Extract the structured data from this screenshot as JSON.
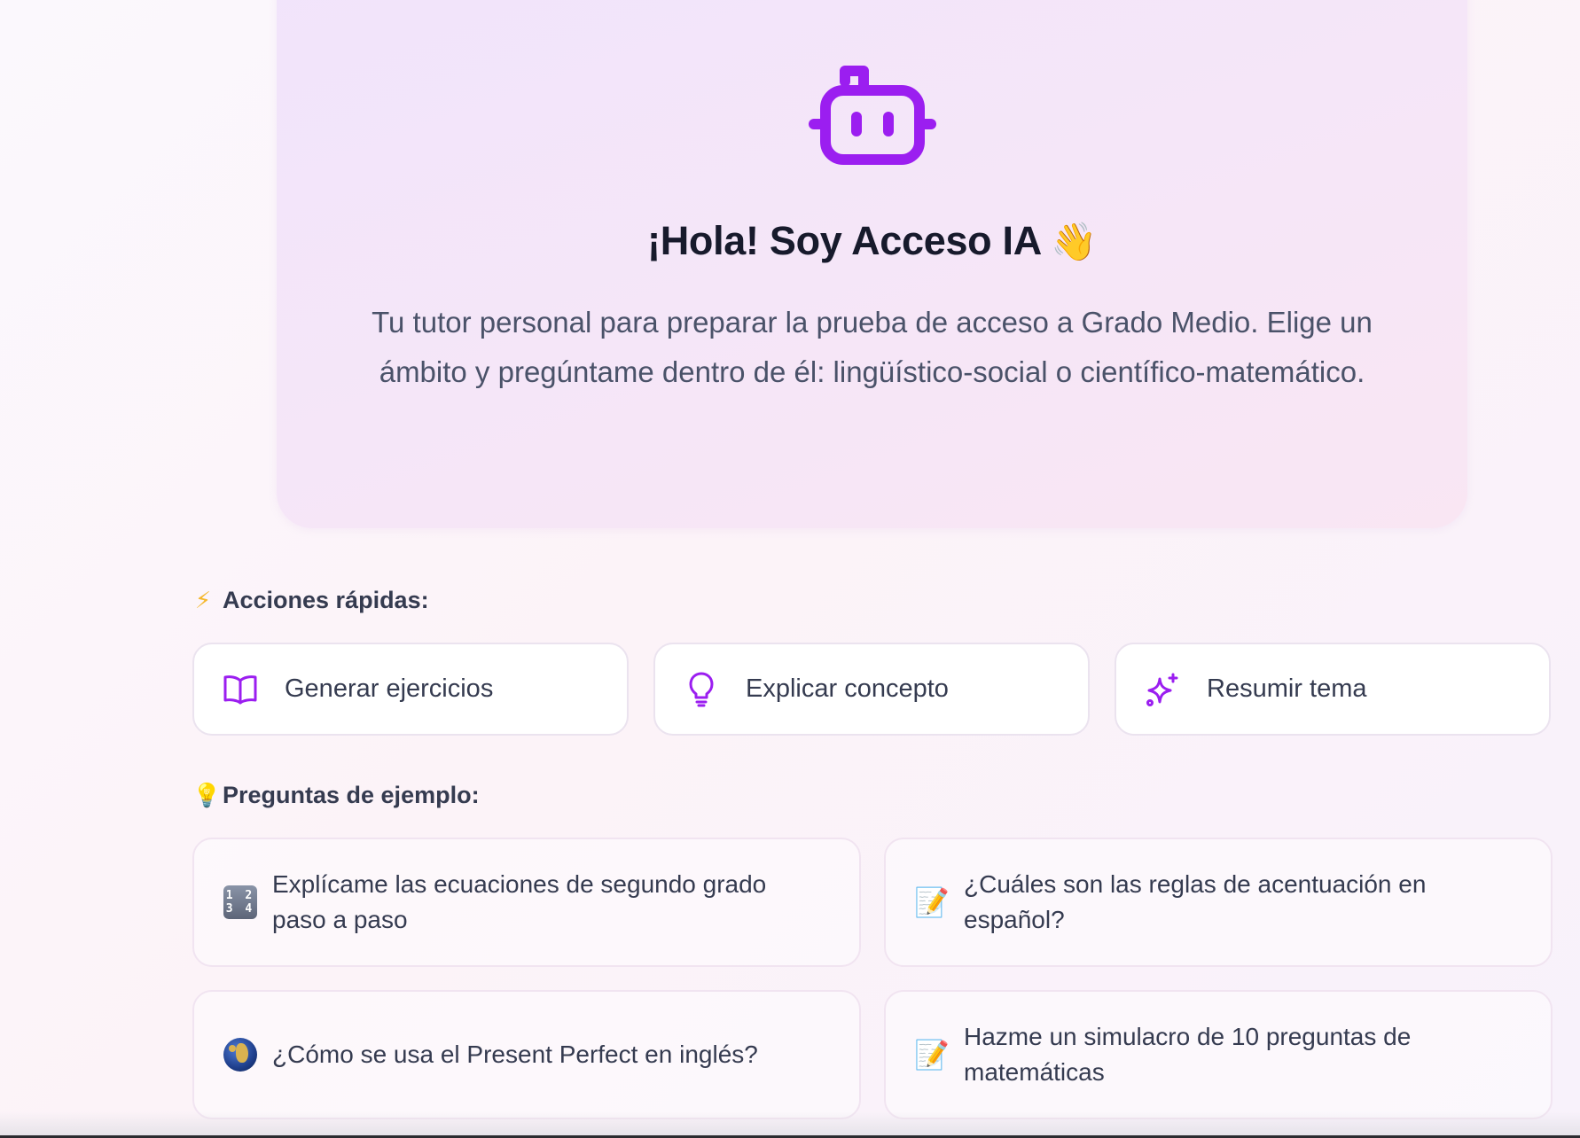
{
  "hero": {
    "title": "¡Hola! Soy Acceso IA",
    "title_emoji": "👋",
    "subtitle": "Tu tutor personal para preparar la prueba de acceso a Grado Medio. Elige un ámbito y pregúntame dentro de él: lingüístico-social o científico-matemático.",
    "icon": "robot-icon",
    "accent_color": "#9b1ef0"
  },
  "quick_actions": {
    "heading_emoji": "⚡",
    "heading": "Acciones rápidas:",
    "items": [
      {
        "label": "Generar ejercicios",
        "icon": "book-open-icon"
      },
      {
        "label": "Explicar concepto",
        "icon": "lightbulb-icon"
      },
      {
        "label": "Resumir tema",
        "icon": "sparkles-icon"
      }
    ]
  },
  "examples": {
    "heading_emoji": "💡",
    "heading": "Preguntas de ejemplo:",
    "items": [
      {
        "text": "Explícame las ecuaciones de segundo grado paso a paso",
        "icon": "numbers-icon",
        "icon_text_top": "1 2",
        "icon_text_bottom": "3 4"
      },
      {
        "text": "¿Cuáles son las reglas de acentuación en español?",
        "icon": "memo-icon",
        "emoji": "📝"
      },
      {
        "text": "¿Cómo se usa el Present Perfect en inglés?",
        "icon": "globe-icon"
      },
      {
        "text": "Hazme un simulacro de 10 preguntas de matemáticas",
        "icon": "memo-icon",
        "emoji": "📝"
      }
    ]
  }
}
